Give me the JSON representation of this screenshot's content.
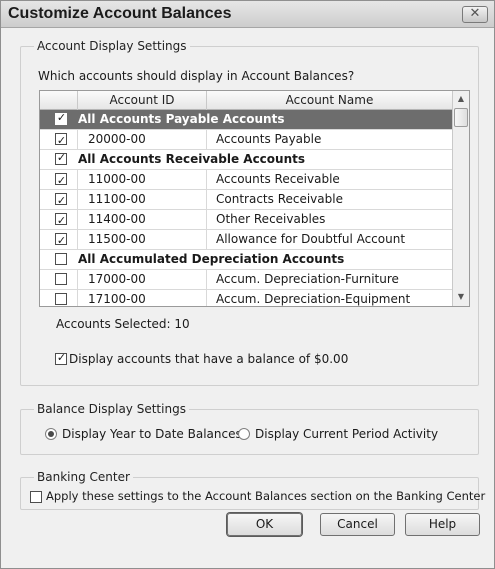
{
  "dialog": {
    "title": "Customize Account Balances",
    "close_icon": "close-icon",
    "close_glyph": "✕"
  },
  "account_display": {
    "group_label": "Account Display Settings",
    "question": "Which accounts should display in Account Balances?",
    "columns": [
      "Account ID",
      "Account Name"
    ],
    "rows": [
      {
        "type": "group",
        "checked": true,
        "selected": true,
        "label": "All Accounts Payable Accounts"
      },
      {
        "type": "account",
        "checked": true,
        "id": "20000-00",
        "name": "Accounts Payable"
      },
      {
        "type": "group",
        "checked": true,
        "label": "All Accounts Receivable Accounts"
      },
      {
        "type": "account",
        "checked": true,
        "id": "11000-00",
        "name": "Accounts Receivable"
      },
      {
        "type": "account",
        "checked": true,
        "id": "11100-00",
        "name": "Contracts Receivable"
      },
      {
        "type": "account",
        "checked": true,
        "id": "11400-00",
        "name": "Other Receivables"
      },
      {
        "type": "account",
        "checked": true,
        "id": "11500-00",
        "name": "Allowance for Doubtful Account"
      },
      {
        "type": "group",
        "checked": false,
        "label": "All Accumulated Depreciation Accounts"
      },
      {
        "type": "account",
        "checked": false,
        "id": "17000-00",
        "name": "Accum. Depreciation-Furniture"
      },
      {
        "type": "account",
        "checked": false,
        "id": "17100-00",
        "name": "Accum. Depreciation-Equipment"
      }
    ],
    "accounts_selected": "Accounts Selected: 10",
    "zero_balance": {
      "label": "Display accounts that have a balance of $0.00",
      "checked": true
    }
  },
  "balance_display": {
    "group_label": "Balance Display Settings",
    "options": [
      {
        "label": "Display Year to Date Balances",
        "selected": true
      },
      {
        "label": "Display Current Period Activity",
        "selected": false
      }
    ]
  },
  "banking_center": {
    "group_label": "Banking Center",
    "apply": {
      "label": "Apply these settings to the Account Balances section on the Banking Center",
      "checked": false
    }
  },
  "buttons": {
    "ok": "OK",
    "cancel": "Cancel",
    "help": "Help"
  },
  "scrollbar": {
    "up_icon": "scroll-up-arrow-icon",
    "down_icon": "scroll-down-arrow-icon",
    "up": "▲",
    "down": "▼"
  },
  "check_glyph": "✓"
}
